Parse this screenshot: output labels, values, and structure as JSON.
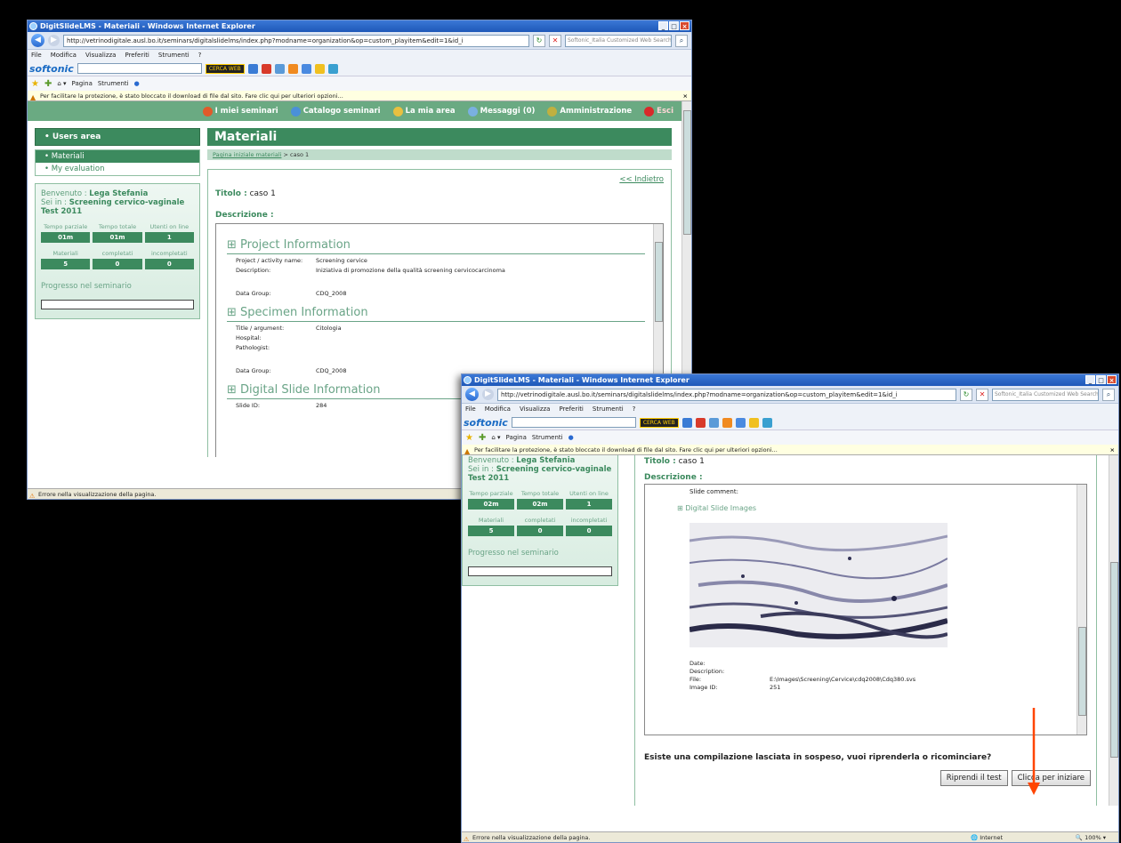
{
  "browser": {
    "title": "DigitSlideLMS - Materiali - Windows Internet Explorer",
    "url": "http://vetrinodigitale.ausl.bo.it/seminars/digitalslidelms/index.php?modname=organization&op=custom_playitem&edit=1&id_i",
    "search_placeholder": "Softonic_Italia Customized Web Search",
    "menu": [
      "File",
      "Modifica",
      "Visualizza",
      "Preferiti",
      "Strumenti",
      "?"
    ],
    "softonic_label": "softonic",
    "cerca_label": "CERCA WEB",
    "fav_pagina": "Pagina",
    "fav_strumenti": "Strumenti",
    "infobar": "Per facilitare la protezione, è stato bloccato il download di file dal sito. Fare clic qui per ulteriori opzioni...",
    "status": "Errore nella visualizzazione della pagina.",
    "status_zone": "Internet",
    "zoom": "100%"
  },
  "nav": {
    "items": [
      "I miei seminari",
      "Catalogo seminari",
      "La mia area",
      "Messaggi (0)",
      "Amministrazione",
      "Esci"
    ]
  },
  "sidebar": {
    "users_area": "Users area",
    "menu": [
      "Materiali",
      "My evaluation"
    ],
    "welcome_prefix": "Benvenuto : ",
    "user": "Lega Stefania",
    "sei_in": "Sei in : ",
    "course": "Screening cervico-vaginale Test 2011",
    "stat_labels": [
      "Tempo parziale",
      "Tempo totale",
      "Utenti on line"
    ],
    "stats_w1": [
      "01m",
      "01m",
      "1"
    ],
    "stats_w2": [
      "02m",
      "02m",
      "1"
    ],
    "mat_labels": [
      "Materiali",
      "completati",
      "incompletati"
    ],
    "mat_values": [
      "5",
      "0",
      "0"
    ],
    "progress_label": "Progresso nel seminario"
  },
  "main": {
    "title": "Materiali",
    "breadcrumb_link": "Pagina iniziale materiali",
    "breadcrumb_current": " > caso 1",
    "back": "<< Indietro",
    "titolo_label": "Titolo :",
    "titolo_value": " caso 1",
    "descr_label": "Descrizione :",
    "project_info": "Project Information",
    "project_rows": [
      [
        "Project / activity name:",
        "Screening cervice"
      ],
      [
        "Description:",
        "Iniziativa di promozione della qualità screening cervicocarcinoma"
      ],
      [
        "Data Group:",
        "CDQ_2008"
      ]
    ],
    "specimen_info": "Specimen Information",
    "specimen_rows": [
      [
        "Title / argument:",
        "Citologia"
      ],
      [
        "Hospital:",
        ""
      ],
      [
        "Pathologist:",
        ""
      ],
      [
        "Data Group:",
        "CDQ_2008"
      ]
    ],
    "digital_info": "Digital Slide Information",
    "slide_id_label": "Slide ID:",
    "slide_id": "284",
    "slide_comment": "Slide comment:",
    "digital_images": "Digital Slide Images",
    "img_rows": [
      [
        "Date:",
        ""
      ],
      [
        "Description:",
        ""
      ],
      [
        "File:",
        "E:\\Images\\Screening\\Cervice\\cdq2008\\Cdq380.svs"
      ],
      [
        "Image ID:",
        "251"
      ]
    ],
    "question": "Esiste una compilazione lasciata in sospeso, vuoi riprenderla o ricominciare?",
    "btn_riprendi": "Riprendi il test",
    "btn_inizia": "Clicca per iniziare"
  },
  "colors": {
    "accent": "#3c8a5e",
    "arrow": "#ff4500"
  }
}
